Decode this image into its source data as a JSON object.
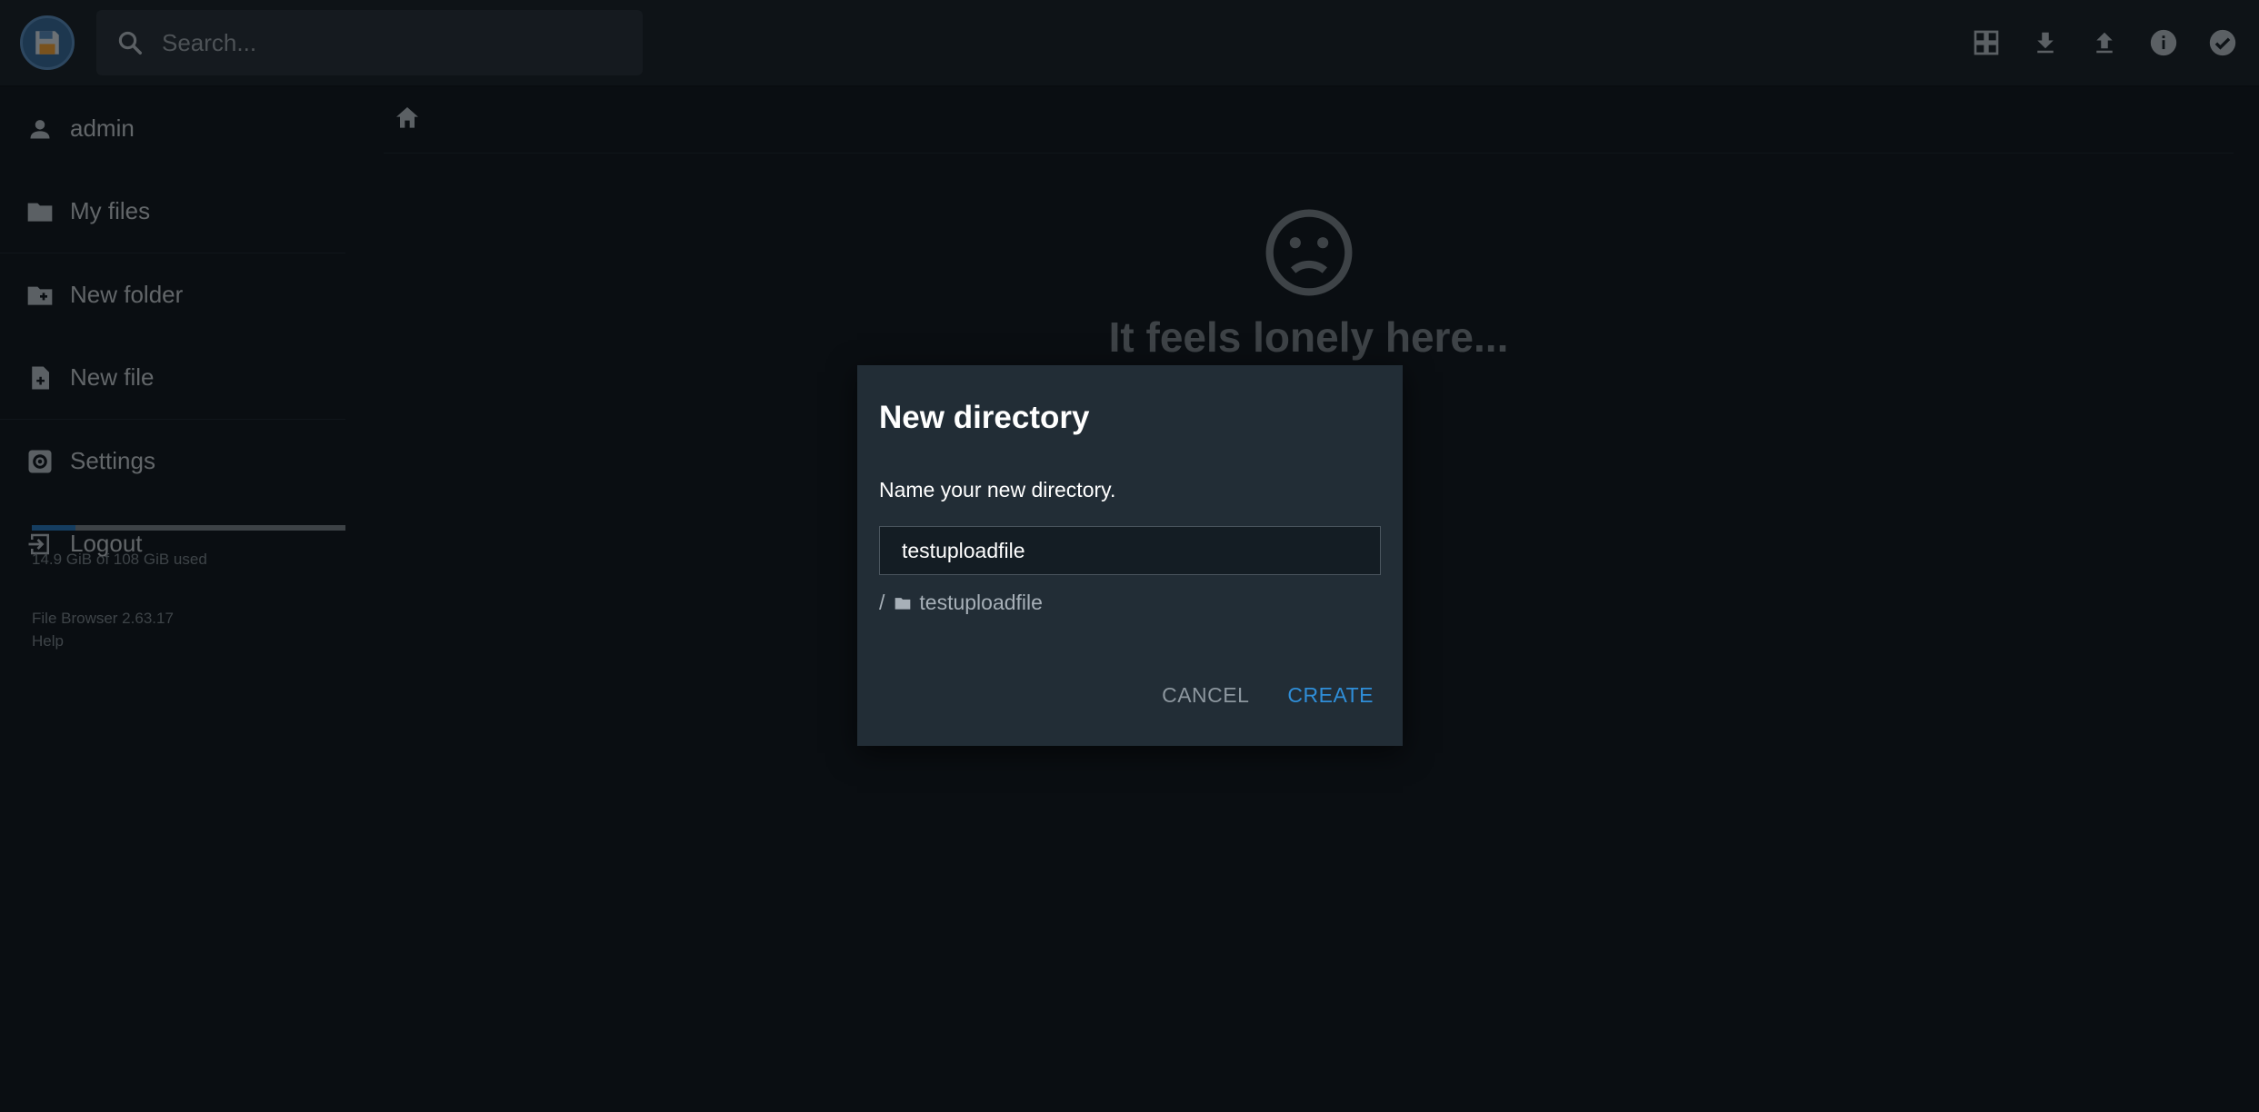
{
  "header": {
    "search_placeholder": "Search...",
    "actions": [
      "grid-view",
      "download",
      "upload",
      "info",
      "select"
    ]
  },
  "sidebar": {
    "items": [
      {
        "label": "admin",
        "icon": "person-icon"
      },
      {
        "label": "My files",
        "icon": "folder-icon"
      },
      {
        "label": "New folder",
        "icon": "folder-plus-icon"
      },
      {
        "label": "New file",
        "icon": "file-plus-icon"
      },
      {
        "label": "Settings",
        "icon": "gear-icon"
      },
      {
        "label": "Logout",
        "icon": "logout-icon"
      }
    ],
    "quota": {
      "text": "14.9 GiB of 108 GiB used",
      "used_fraction": 0.138
    },
    "version": "File Browser 2.63.17",
    "help": "Help"
  },
  "main": {
    "empty_message": "It feels lonely here..."
  },
  "dialog": {
    "title": "New directory",
    "prompt": "Name your new directory.",
    "input_value": "testuploadfile",
    "path_slash": "/",
    "path_name": "testuploadfile",
    "cancel": "CANCEL",
    "create": "CREATE"
  },
  "colors": {
    "accent": "#2f8ed8",
    "background": "#141d24",
    "dialog": "#222d36"
  }
}
